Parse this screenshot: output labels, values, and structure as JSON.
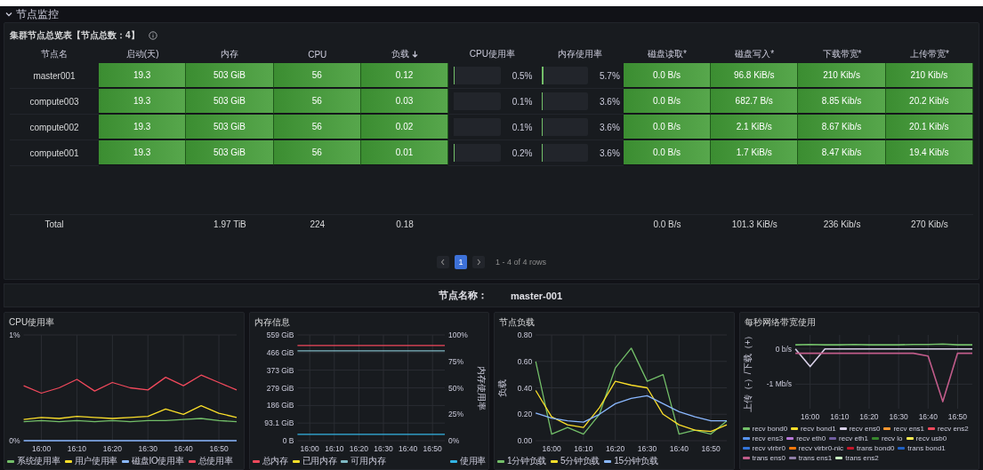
{
  "section": {
    "title": "节点监控",
    "expanded": true
  },
  "overview": {
    "title": "集群节点总览表【节点总数：4】",
    "columns": [
      {
        "label": "节点名",
        "kind": "name"
      },
      {
        "label": "启动(天)",
        "kind": "fill"
      },
      {
        "label": "内存",
        "kind": "fill"
      },
      {
        "label": "CPU",
        "kind": "fill"
      },
      {
        "label": "负载",
        "kind": "fill",
        "sorted": true
      },
      {
        "label": "CPU使用率",
        "kind": "gauge"
      },
      {
        "label": "内存使用率",
        "kind": "gauge"
      },
      {
        "label": "磁盘读取*",
        "kind": "fill"
      },
      {
        "label": "磁盘写入*",
        "kind": "fill"
      },
      {
        "label": "下载带宽*",
        "kind": "fill"
      },
      {
        "label": "上传带宽*",
        "kind": "fill"
      }
    ],
    "rows": [
      {
        "cells": [
          "master001",
          "19.3",
          "503 GiB",
          "56",
          "0.12",
          {
            "level": 0.005,
            "reading": "0.5%"
          },
          {
            "level": 0.057,
            "reading": "5.7%"
          },
          "0.0 B/s",
          "96.8 KiB/s",
          "210 Kib/s",
          "210 Kib/s"
        ]
      },
      {
        "cells": [
          "compute003",
          "19.3",
          "503 GiB",
          "56",
          "0.03",
          {
            "level": 0.001,
            "reading": "0.1%"
          },
          {
            "level": 0.036,
            "reading": "3.6%"
          },
          "0.0 B/s",
          "682.7 B/s",
          "8.85 Kib/s",
          "20.2 Kib/s"
        ]
      },
      {
        "cells": [
          "compute002",
          "19.3",
          "503 GiB",
          "56",
          "0.02",
          {
            "level": 0.001,
            "reading": "0.1%"
          },
          {
            "level": 0.036,
            "reading": "3.6%"
          },
          "0.0 B/s",
          "2.1 KiB/s",
          "8.67 Kib/s",
          "20.1 Kib/s"
        ]
      },
      {
        "cells": [
          "compute001",
          "19.3",
          "503 GiB",
          "56",
          "0.01",
          {
            "level": 0.002,
            "reading": "0.2%"
          },
          {
            "level": 0.036,
            "reading": "3.6%"
          },
          "0.0 B/s",
          "1.7 KiB/s",
          "8.47 Kib/s",
          "19.4 Kib/s"
        ]
      }
    ],
    "totals": [
      {
        "kind": "value",
        "text": "Total"
      },
      {
        "kind": "blank"
      },
      {
        "kind": "value",
        "text": "1.97 TiB"
      },
      {
        "kind": "value",
        "text": "224"
      },
      {
        "kind": "value",
        "text": "0.18"
      },
      {
        "kind": "blank"
      },
      {
        "kind": "blank"
      },
      {
        "kind": "value",
        "text": "0.0 B/s"
      },
      {
        "kind": "value",
        "text": "101.3 KiB/s"
      },
      {
        "kind": "value",
        "text": "236 Kib/s"
      },
      {
        "kind": "value",
        "text": "270 Kib/s"
      }
    ],
    "pagination": {
      "pages": [
        {
          "label": "1",
          "selected": true
        }
      ],
      "summary": "1 - 4 of 4 rows"
    }
  },
  "variable": {
    "label": "节点名称：",
    "value": "master-001"
  },
  "panels": [
    {
      "title": "CPU使用率",
      "chart_data": {
        "type": "line",
        "grid": true,
        "categories": [
          null,
          "16:00",
          null,
          "16:10",
          null,
          "16:20",
          null,
          "16:30",
          null,
          "16:40",
          null,
          "16:50",
          null
        ],
        "ylim": [
          0,
          1
        ],
        "yticks": [
          {
            "value": 0,
            "label": "0%"
          },
          {
            "value": 1,
            "label": "1%"
          }
        ],
        "series": [
          {
            "name": "系统使用率",
            "color": "#73bf69",
            "values": [
              0.18,
              0.19,
              0.18,
              0.19,
              0.18,
              0.19,
              0.18,
              0.19,
              0.19,
              0.2,
              0.21,
              0.19,
              0.18
            ]
          },
          {
            "name": "用户使用率",
            "color": "#fade2a",
            "values": [
              0.2,
              0.22,
              0.21,
              0.23,
              0.22,
              0.21,
              0.22,
              0.23,
              0.3,
              0.25,
              0.33,
              0.26,
              0.22
            ]
          },
          {
            "name": "磁盘IO使用率",
            "color": "#8ab8ff",
            "values": [
              0,
              0,
              0,
              0,
              0,
              0,
              0,
              0,
              0,
              0,
              0,
              0,
              0
            ]
          },
          {
            "name": "总使用率",
            "color": "#f2495c",
            "values": [
              0.52,
              0.45,
              0.5,
              0.58,
              0.47,
              0.55,
              0.5,
              0.48,
              0.6,
              0.52,
              0.62,
              0.55,
              0.48
            ]
          }
        ]
      }
    },
    {
      "title": "内存信息",
      "chart_data": {
        "type": "line",
        "grid": true,
        "categories": [
          null,
          "16:00",
          null,
          "16:10",
          null,
          "16:20",
          null,
          "16:30",
          null,
          "16:40",
          null,
          "16:50",
          null
        ],
        "ylim": [
          0,
          559
        ],
        "yticks": [
          {
            "value": 0,
            "label": "0 B"
          },
          {
            "value": 93.1,
            "label": "93.1 GiB"
          },
          {
            "value": 186,
            "label": "186 GiB"
          },
          {
            "value": 279,
            "label": "279 GiB"
          },
          {
            "value": 373,
            "label": "373 GiB"
          },
          {
            "value": 466,
            "label": "466 GiB"
          },
          {
            "value": 559,
            "label": "559 GiB"
          }
        ],
        "y2label": "内存使用率",
        "y2lim": [
          0,
          100
        ],
        "y2ticks": [
          {
            "value": 100,
            "label": "100%"
          },
          {
            "value": 75,
            "label": "75%"
          },
          {
            "value": 50,
            "label": "50%"
          },
          {
            "value": 25,
            "label": "25%"
          },
          {
            "value": 0,
            "label": "0%"
          }
        ],
        "series": [
          {
            "name": "总内存",
            "color": "#f2495c",
            "values": [
              503,
              503,
              503,
              503,
              503,
              503,
              503,
              503,
              503,
              503,
              503,
              503,
              503
            ]
          },
          {
            "name": "已用内存",
            "color": "#fade2a",
            "values": [
              null,
              null,
              null,
              null,
              null,
              null,
              null,
              null,
              null,
              null,
              null,
              null,
              null
            ]
          },
          {
            "name": "可用内存",
            "color": "#7fb9c4",
            "values": [
              475,
              475,
              475,
              475,
              475,
              475,
              475,
              475,
              475,
              475,
              475,
              475,
              475
            ]
          },
          {
            "name": "使用率",
            "color": "#33b5e5",
            "axis": "y2",
            "values": [
              6,
              6,
              6,
              6,
              6,
              6,
              6,
              6,
              6,
              6,
              6,
              6,
              6
            ]
          }
        ]
      }
    },
    {
      "title": "节点负载",
      "chart_data": {
        "type": "line",
        "grid": true,
        "ylabel": "负载",
        "categories": [
          null,
          "16:00",
          null,
          "16:10",
          null,
          "16:20",
          null,
          "16:30",
          null,
          "16:40",
          null,
          "16:50",
          null
        ],
        "ylim": [
          0,
          0.8
        ],
        "yticks": [
          {
            "value": 0,
            "label": "0.00"
          },
          {
            "value": 0.2,
            "label": "0.20"
          },
          {
            "value": 0.4,
            "label": "0.40"
          },
          {
            "value": 0.6,
            "label": "0.60"
          },
          {
            "value": 0.8,
            "label": "0.80"
          }
        ],
        "series": [
          {
            "name": "1分钟负载",
            "color": "#73bf69",
            "values": [
              0.6,
              0.05,
              0.1,
              0.05,
              0.2,
              0.55,
              0.7,
              0.45,
              0.5,
              0.05,
              0.08,
              0.05,
              0.15
            ]
          },
          {
            "name": "5分钟负载",
            "color": "#fade2a",
            "values": [
              0.38,
              0.18,
              0.12,
              0.1,
              0.25,
              0.45,
              0.42,
              0.4,
              0.2,
              0.12,
              0.08,
              0.07,
              0.12
            ]
          },
          {
            "name": "15分钟负载",
            "color": "#8ab8ff",
            "values": [
              0.21,
              0.17,
              0.15,
              0.14,
              0.2,
              0.28,
              0.32,
              0.34,
              0.28,
              0.22,
              0.18,
              0.15,
              0.15
            ]
          }
        ]
      }
    },
    {
      "title": "每秒网络带宽使用",
      "chart_data": {
        "type": "line",
        "grid": true,
        "ylabel": "上传（-）/下载（+）",
        "categories": [
          null,
          "16:00",
          null,
          "16:10",
          null,
          "16:20",
          null,
          "16:30",
          null,
          "16:40",
          null,
          "16:50",
          null
        ],
        "ylim": [
          -1.7,
          0.4
        ],
        "yticks": [
          {
            "value": 0,
            "label": "0 b/s"
          },
          {
            "value": -1,
            "label": "-1 Mb/s"
          }
        ],
        "series": [
          {
            "name": "recv bond0",
            "color": "#73bf69",
            "values": [
              0.12,
              0.13,
              0.12,
              0.12,
              0.13,
              0.12,
              0.12,
              0.12,
              0.13,
              0.13,
              0.14,
              0.12,
              0.12
            ]
          },
          {
            "name": "recv bond1",
            "color": "#fade2a",
            "values": [
              null,
              null,
              null,
              null,
              null,
              null,
              null,
              null,
              null,
              null,
              null,
              null,
              null
            ]
          },
          {
            "name": "recv ens0",
            "color": "#d8d0e8",
            "values": [
              0,
              -0.5,
              0,
              0,
              0,
              0,
              0,
              0,
              0,
              0,
              0,
              0,
              0
            ]
          },
          {
            "name": "recv ens1",
            "color": "#ff9830",
            "values": [
              null,
              null,
              null,
              null,
              null,
              null,
              null,
              null,
              null,
              null,
              null,
              null,
              null
            ]
          },
          {
            "name": "recv ens2",
            "color": "#f2495c",
            "values": [
              null,
              null,
              null,
              null,
              null,
              null,
              null,
              null,
              null,
              null,
              null,
              null,
              null
            ]
          },
          {
            "name": "recv ens3",
            "color": "#5794f2",
            "values": [
              null,
              null,
              null,
              null,
              null,
              null,
              null,
              null,
              null,
              null,
              null,
              null,
              null
            ]
          },
          {
            "name": "recv eth0",
            "color": "#b877d9",
            "values": [
              null,
              null,
              null,
              null,
              null,
              null,
              null,
              null,
              null,
              null,
              null,
              null,
              null
            ]
          },
          {
            "name": "recv eth1",
            "color": "#705da0",
            "values": [
              null,
              null,
              null,
              null,
              null,
              null,
              null,
              null,
              null,
              null,
              null,
              null,
              null
            ]
          },
          {
            "name": "recv lo",
            "color": "#37872d",
            "values": [
              null,
              null,
              null,
              null,
              null,
              null,
              null,
              null,
              null,
              null,
              null,
              null,
              null
            ]
          },
          {
            "name": "recv usb0",
            "color": "#ffee52",
            "values": [
              null,
              null,
              null,
              null,
              null,
              null,
              null,
              null,
              null,
              null,
              null,
              null,
              null
            ]
          },
          {
            "name": "recv virbr0",
            "color": "#3274d9",
            "values": [
              null,
              null,
              null,
              null,
              null,
              null,
              null,
              null,
              null,
              null,
              null,
              null,
              null
            ]
          },
          {
            "name": "recv virbr0-nic",
            "color": "#ff780a",
            "values": [
              null,
              null,
              null,
              null,
              null,
              null,
              null,
              null,
              null,
              null,
              null,
              null,
              null
            ]
          },
          {
            "name": "trans bond0",
            "color": "#c4162a",
            "values": [
              null,
              null,
              null,
              null,
              null,
              null,
              null,
              null,
              null,
              null,
              null,
              null,
              null
            ]
          },
          {
            "name": "trans bond1",
            "color": "#1f60c4",
            "values": [
              null,
              null,
              null,
              null,
              null,
              null,
              null,
              null,
              null,
              null,
              null,
              null,
              null
            ]
          },
          {
            "name": "trans ens0",
            "color": "#c15c8a",
            "values": [
              -0.12,
              -0.12,
              -0.12,
              -0.12,
              -0.12,
              -0.12,
              -0.12,
              -0.12,
              -0.12,
              -0.2,
              -1.5,
              -0.12,
              -0.12
            ]
          },
          {
            "name": "trans ens1",
            "color": "#8f7fa8",
            "values": [
              null,
              null,
              null,
              null,
              null,
              null,
              null,
              null,
              null,
              null,
              null,
              null,
              null
            ]
          },
          {
            "name": "trans ens2",
            "color": "#c8f2c2",
            "values": [
              null,
              null,
              null,
              null,
              null,
              null,
              null,
              null,
              null,
              null,
              null,
              null,
              null
            ]
          }
        ]
      }
    }
  ]
}
